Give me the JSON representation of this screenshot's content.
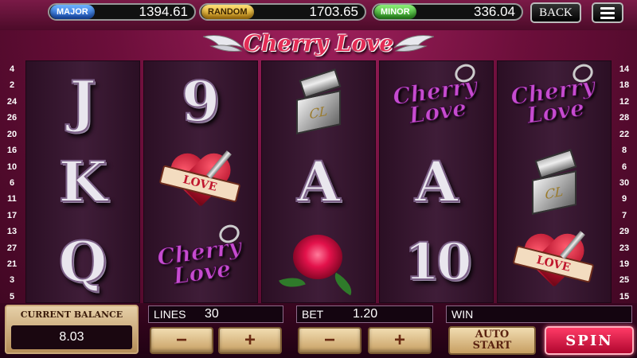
{
  "jackpots": {
    "major": {
      "label": "MAJOR",
      "value": "1394.61"
    },
    "random": {
      "label": "RANDOM",
      "value": "1703.65"
    },
    "minor": {
      "label": "MINOR",
      "value": "336.04"
    }
  },
  "header": {
    "back_label": "BACK",
    "menu_icon": "hamburger-menu-icon"
  },
  "logo": {
    "title": "Cherry Love"
  },
  "paylines": {
    "left": [
      "4",
      "2",
      "24",
      "26",
      "20",
      "16",
      "10",
      "6",
      "11",
      "17",
      "13",
      "27",
      "21",
      "3",
      "5"
    ],
    "right": [
      "14",
      "18",
      "12",
      "28",
      "22",
      "8",
      "6",
      "30",
      "9",
      "7",
      "29",
      "23",
      "19",
      "25",
      "15"
    ]
  },
  "reels": [
    [
      {
        "symbol": "J"
      },
      {
        "symbol": "K"
      },
      {
        "symbol": "Q"
      }
    ],
    [
      {
        "symbol": "9"
      },
      {
        "symbol": "heart-love",
        "text": "LOVE"
      },
      {
        "symbol": "cherry-love",
        "text": "Cherry Love"
      }
    ],
    [
      {
        "symbol": "lighter",
        "text": "CL"
      },
      {
        "symbol": "A"
      },
      {
        "symbol": "rose"
      }
    ],
    [
      {
        "symbol": "cherry-love",
        "text": "Cherry Love"
      },
      {
        "symbol": "A"
      },
      {
        "symbol": "10"
      }
    ],
    [
      {
        "symbol": "cherry-love",
        "text": "Cherry Love"
      },
      {
        "symbol": "lighter",
        "text": "CL"
      },
      {
        "symbol": "heart-love",
        "text": "LOVE"
      }
    ]
  ],
  "balance": {
    "label": "CURRENT BALANCE",
    "value": "8.03"
  },
  "lines": {
    "label": "LINES",
    "value": "30",
    "minus": "−",
    "plus": "+"
  },
  "bet": {
    "label": "BET",
    "value": "1.20",
    "minus": "−",
    "plus": "+"
  },
  "win": {
    "label": "WIN",
    "value": ""
  },
  "buttons": {
    "auto_line1": "AUTO",
    "auto_line2": "START",
    "spin": "SPIN"
  }
}
